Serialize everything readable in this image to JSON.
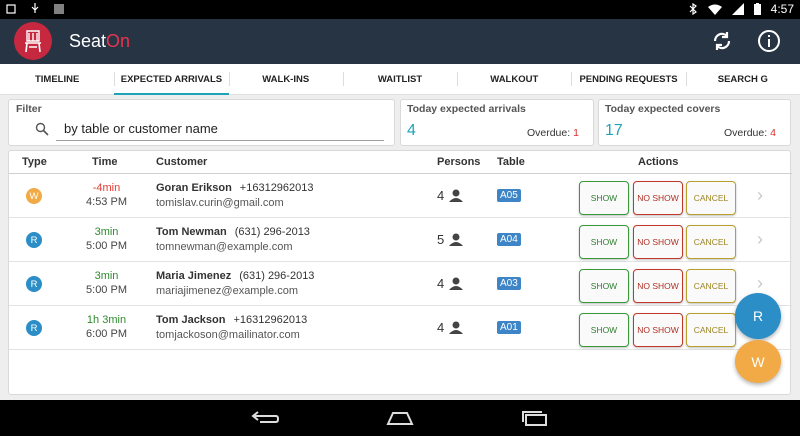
{
  "status_bar": {
    "time": "4:57"
  },
  "app": {
    "title_main": "Seat",
    "title_accent": "On",
    "accent_color": "#e8344e",
    "logo_color": "#c5283f"
  },
  "tabs": [
    {
      "label": "TIMELINE"
    },
    {
      "label": "EXPECTED ARRIVALS",
      "active": true
    },
    {
      "label": "WALK-INS"
    },
    {
      "label": "WAITLIST"
    },
    {
      "label": "WALKOUT"
    },
    {
      "label": "PENDING REQUESTS"
    },
    {
      "label": "SEARCH"
    }
  ],
  "filter": {
    "label": "Filter",
    "placeholder": "by table or customer name"
  },
  "stats": {
    "arrivals": {
      "title": "Today expected arrivals",
      "value": "4",
      "overdue_label": "Overdue:",
      "overdue": "1"
    },
    "covers": {
      "title": "Today expected covers",
      "value": "17",
      "overdue_label": "Overdue:",
      "overdue": "4"
    }
  },
  "table": {
    "headers": {
      "type": "Type",
      "time": "Time",
      "customer": "Customer",
      "persons": "Persons",
      "table": "Table",
      "actions": "Actions"
    },
    "action_labels": {
      "show": "SHOW",
      "no_show": "NO SHOW",
      "cancel": "CANCEL"
    },
    "rows": [
      {
        "type": "W",
        "type_color": "#f1aa46",
        "relative": "-4min",
        "relative_color": "#e03c31",
        "time": "4:53 PM",
        "name": "Goran Erikson",
        "phone": "+16312962013",
        "email": "tomislav.curin@gmail.com",
        "persons": "4",
        "table": "A05"
      },
      {
        "type": "R",
        "type_color": "#2b8ec6",
        "relative": "3min",
        "relative_color": "#2f8a2f",
        "time": "5:00 PM",
        "name": "Tom Newman",
        "phone": "(631) 296-2013",
        "email": "tomnewman@example.com",
        "persons": "5",
        "table": "A04"
      },
      {
        "type": "R",
        "type_color": "#2b8ec6",
        "relative": "3min",
        "relative_color": "#2f8a2f",
        "time": "5:00 PM",
        "name": "Maria Jimenez",
        "phone": "(631) 296-2013",
        "email": "mariajimenez@example.com",
        "persons": "4",
        "table": "A03"
      },
      {
        "type": "R",
        "type_color": "#2b8ec6",
        "relative": "1h 3min",
        "relative_color": "#2f8a2f",
        "time": "6:00 PM",
        "name": "Tom Jackson",
        "phone": "+16312962013",
        "email": "tomjackoson@mailinator.com",
        "persons": "4",
        "table": "A01"
      }
    ]
  },
  "fabs": {
    "reservation": "R",
    "walkin": "W"
  }
}
